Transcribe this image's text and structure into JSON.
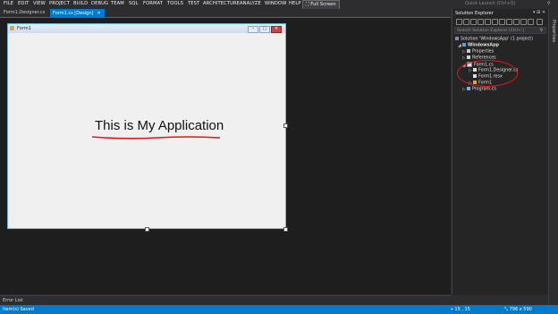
{
  "menu": {
    "items": [
      "FILE",
      "EDIT",
      "VIEW",
      "PROJECT",
      "BUILD",
      "DEBUG",
      "TEAM",
      "SQL",
      "FORMAT",
      "TOOLS",
      "TEST",
      "ARCHITECTURE",
      "ANALYZE",
      "WINDOW",
      "HELP"
    ],
    "fullscreen": "Full Screen",
    "quick_launch": "Quick Launch (Ctrl+Q)"
  },
  "tabs": [
    {
      "label": "Form1.Designer.cs"
    },
    {
      "label": "Form1.cs [Design]",
      "close": "✕"
    }
  ],
  "form": {
    "title": "Form1",
    "label": "This is My Application",
    "min": "–",
    "max": "□",
    "close": "✕"
  },
  "solution_explorer": {
    "title": "Solution Explorer",
    "pins": "▾ ⊞ ✕",
    "search_placeholder": "Search Solution Explorer (Ctrl+;)",
    "tree": [
      {
        "label": "Solution 'WindowsApp' (1 project)"
      },
      {
        "label": "WindowsApp"
      },
      {
        "label": "Properties"
      },
      {
        "label": "References"
      },
      {
        "label": "Form1.cs"
      },
      {
        "label": "Form1.Designer.cs"
      },
      {
        "label": "Form1.resx"
      },
      {
        "label": "Form1"
      },
      {
        "label": "Program.cs"
      }
    ]
  },
  "properties_strip": "Properties",
  "error_list": "Error List",
  "status": {
    "text": "Item(s) Saved",
    "position": "15 , 15",
    "size": "796 x 590"
  },
  "colors": {
    "accent": "#007acc",
    "highlight": "#e01818"
  }
}
